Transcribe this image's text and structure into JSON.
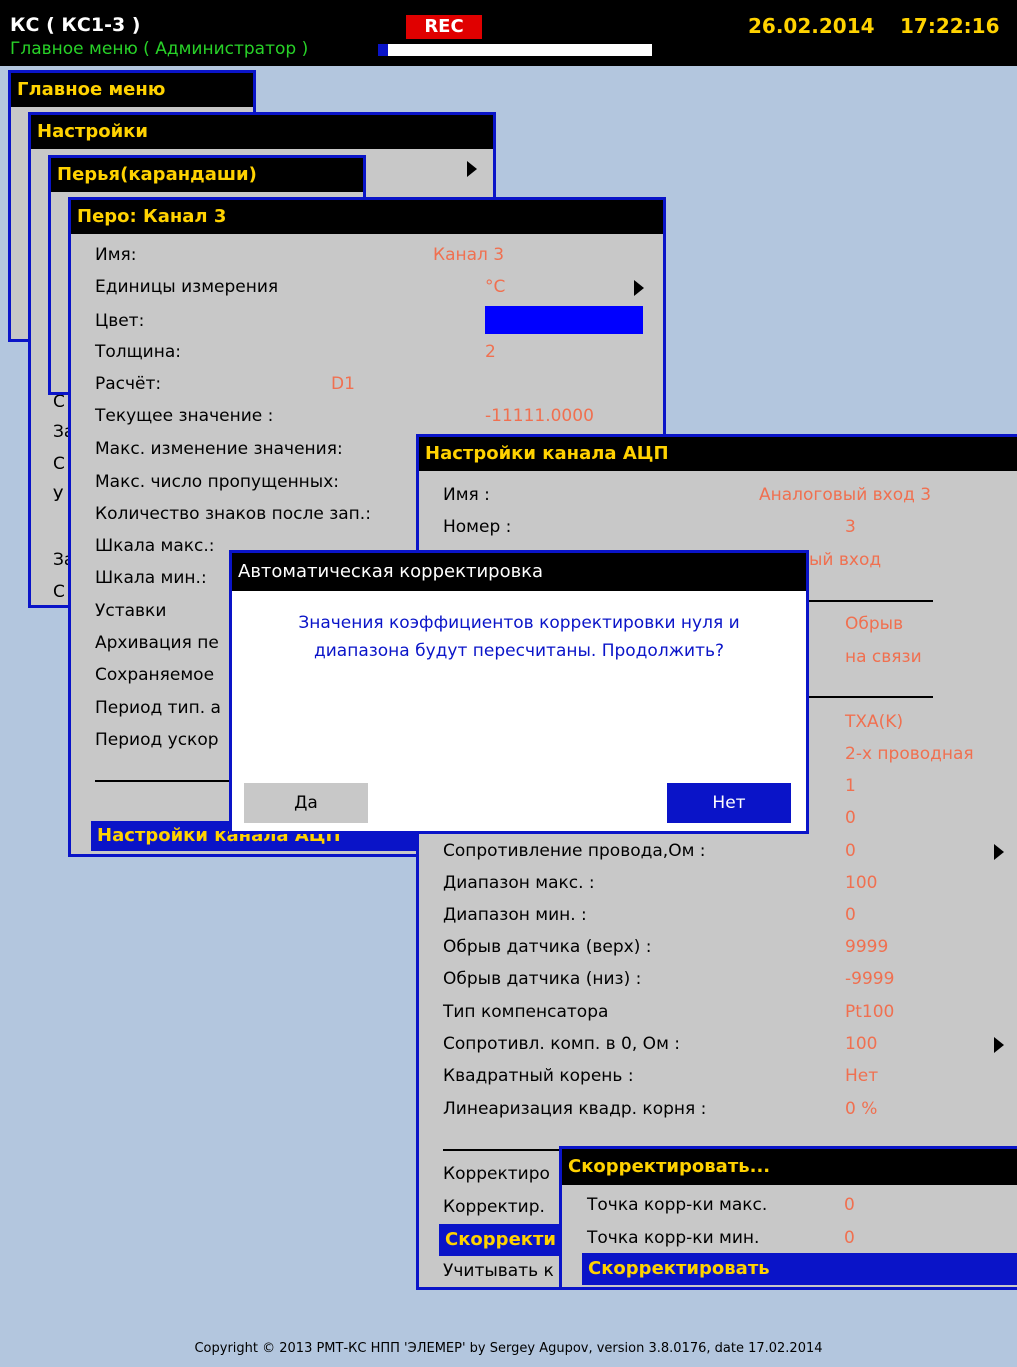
{
  "header": {
    "device": "КС ( КС1-3 )",
    "subtitle": "Главное меню ( Администратор )",
    "rec": "REC",
    "date": "26.02.2014",
    "time": "17:22:16"
  },
  "colors": {
    "accent_blue": "#0a14c8",
    "title_yellow": "#ffd200",
    "value_orange": "#f07050",
    "rec_red": "#e00000",
    "subtitle_green": "#28d228",
    "panel_gray": "#c8c8c8",
    "background": "#b3c6de"
  },
  "main_menu": {
    "title": "Главное меню"
  },
  "settings_menu": {
    "title": "Настройки",
    "left_fragments": [
      "С",
      "За",
      "С",
      "У",
      "За",
      "С"
    ]
  },
  "pens_menu": {
    "title": "Перья(карандаши)"
  },
  "pen_window": {
    "title": "Перо: Канал 3",
    "rows": [
      {
        "label": "Имя:",
        "value": "Канал 3"
      },
      {
        "label": "Единицы измерения",
        "value": "°C"
      },
      {
        "label": "Цвет:",
        "value": ""
      },
      {
        "label": "Толщина:",
        "value": "2"
      },
      {
        "label": "Расчёт:",
        "value": "D1"
      },
      {
        "label": "Текущее значение :",
        "value": "-11111.0000"
      },
      {
        "label": "Макс. изменение значения:",
        "value": ""
      },
      {
        "label": "Макс. число пропущенных:",
        "value": ""
      },
      {
        "label": "Количество знаков после зап.:",
        "value": ""
      },
      {
        "label": "Шкала макс.:",
        "value": ""
      },
      {
        "label": "Шкала мин.:",
        "value": ""
      },
      {
        "label": "Уставки",
        "value": ""
      },
      {
        "label": "Архивация пе",
        "value": ""
      },
      {
        "label": "Сохраняемое",
        "value": ""
      },
      {
        "label": "Период тип. а",
        "value": ""
      },
      {
        "label": "Период ускор",
        "value": ""
      }
    ],
    "selected_item": "Настройки канала АЦП"
  },
  "adc_window": {
    "title": "Настройки канала АЦП",
    "rows": [
      {
        "label": "Имя :",
        "value": "Аналоговый вход 3"
      },
      {
        "label": "Номер :",
        "value": "3"
      },
      {
        "label": "",
        "value": "ый вход"
      },
      {
        "label": "",
        "value": "Обрыв"
      },
      {
        "label": "",
        "value": "на связи"
      },
      {
        "label": "",
        "value": "ТХА(K)"
      },
      {
        "label": "",
        "value": "2-х проводная"
      },
      {
        "label": "",
        "value": "1"
      },
      {
        "label": "",
        "value": "0"
      },
      {
        "label": "Сопротивление провода,Ом :",
        "value": "0"
      },
      {
        "label": "Диапазон макс. :",
        "value": "100"
      },
      {
        "label": "Диапазон мин. :",
        "value": "0"
      },
      {
        "label": "Обрыв датчика (верх) :",
        "value": "9999"
      },
      {
        "label": "Обрыв датчика (низ) :",
        "value": "-9999"
      },
      {
        "label": "Тип компенсатора",
        "value": "Pt100"
      },
      {
        "label": "Сопротивл. комп. в 0, Ом :",
        "value": "100"
      },
      {
        "label": "Квадратный корень :",
        "value": "Нет"
      },
      {
        "label": "Линеаризация квадр. корня :",
        "value": "0 %"
      }
    ],
    "bottom_items": [
      "Корректиро",
      "Корректир.",
      "Скорректи",
      "Учитывать к"
    ]
  },
  "correct_window": {
    "title": "Скорректировать...",
    "rows": [
      {
        "label": "Точка корр-ки макс.",
        "value": "0"
      },
      {
        "label": "Точка корр-ки мин.",
        "value": "0"
      }
    ],
    "selected_item": "Скорректировать"
  },
  "dialog": {
    "title": "Автоматическая корректировка",
    "message_line1": "Значения коэффициентов корректировки нуля и",
    "message_line2": "диапазона будут пересчитаны. Продолжить?",
    "yes_label": "Да",
    "no_label": "Нет"
  },
  "footer": {
    "copyright": "Copyright © 2013 РМТ-КС НПП 'ЭЛЕМЕР' by Sergey Agupov, version 3.8.0176, date 17.02.2014"
  }
}
